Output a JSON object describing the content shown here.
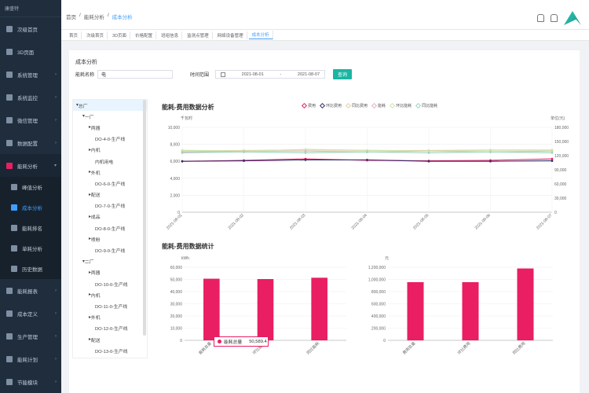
{
  "sidebar": {
    "brand": "康盛特",
    "items": [
      {
        "label": "次级首页"
      },
      {
        "label": "3D页面"
      },
      {
        "label": "系统管理"
      },
      {
        "label": "系统监控"
      },
      {
        "label": "微信管理"
      },
      {
        "label": "数据配置"
      },
      {
        "label": "能耗分析"
      },
      {
        "label": "能耗报表"
      },
      {
        "label": "成本定义"
      },
      {
        "label": "生产管理"
      },
      {
        "label": "能耗计划"
      },
      {
        "label": "节能模块"
      }
    ],
    "subitems": [
      {
        "label": "峰值分析"
      },
      {
        "label": "成本分析"
      },
      {
        "label": "能耗排名"
      },
      {
        "label": "单耗分析"
      },
      {
        "label": "历史数据"
      }
    ]
  },
  "breadcrumb": {
    "home": "首页",
    "sep": "/",
    "parent": "能耗分析",
    "current": "成本分析"
  },
  "tabs": [
    "首页",
    "次级首页",
    "3D页面",
    "价格配置",
    "班组信息",
    "监测点管理",
    "网络设备管理",
    "成本分析"
  ],
  "filter": {
    "title": "成本分析",
    "dim_label": "能耗名称",
    "dim_value": "电",
    "time_label": "时间范围",
    "start": "2021-08-01",
    "dash": "-",
    "end": "2021-08-07",
    "query": "查询"
  },
  "tree": [
    {
      "label": "总厂",
      "level": 0
    },
    {
      "label": "一厂",
      "level": 1
    },
    {
      "label": "两器",
      "level": 2
    },
    {
      "label": "DO-4-0-生产线",
      "level": 3
    },
    {
      "label": "内机",
      "level": 2
    },
    {
      "label": "内机用电",
      "level": 3
    },
    {
      "label": "外机",
      "level": 2
    },
    {
      "label": "DO-6-0-生产线",
      "level": 3
    },
    {
      "label": "配送",
      "level": 2
    },
    {
      "label": "DO-7-0-生产线",
      "level": 3
    },
    {
      "label": "成品",
      "level": 2
    },
    {
      "label": "DO-8-0-生产线",
      "level": 3
    },
    {
      "label": "喷粉",
      "level": 2
    },
    {
      "label": "DO-9-0-生产线",
      "level": 3
    },
    {
      "label": "二厂",
      "level": 1
    },
    {
      "label": "两器",
      "level": 2
    },
    {
      "label": "DO-10-0-生产线",
      "level": 3
    },
    {
      "label": "内机",
      "level": 2
    },
    {
      "label": "DO-11-0-生产线",
      "level": 3
    },
    {
      "label": "外机",
      "level": 2
    },
    {
      "label": "DO-12-0-生产线",
      "level": 3
    },
    {
      "label": "配送",
      "level": 2
    },
    {
      "label": "DO-13-0-生产线",
      "level": 3
    },
    {
      "label": "成品",
      "level": 2
    }
  ],
  "chart_data": [
    {
      "type": "line",
      "title": "能耗-费用数据分析",
      "ylabel": "千瓦时",
      "y2label": "单位(元)",
      "ylim": [
        0,
        10000
      ],
      "y2lim": [
        0,
        180000
      ],
      "yticks": [
        "0",
        "2,000",
        "4,000",
        "6,000",
        "8,000",
        "10,000"
      ],
      "y2ticks": [
        "0",
        "30,000",
        "60,000",
        "90,000",
        "120,000",
        "150,000",
        "180,000"
      ],
      "x": [
        "2021-08-01",
        "2021-08-02",
        "2021-08-03",
        "2021-08-04",
        "2021-08-05",
        "2021-08-06",
        "2021-08-07"
      ],
      "legend": [
        "费用",
        "环比费用",
        "同比费用",
        "能耗",
        "环比能耗",
        "同比能耗"
      ],
      "series": [
        {
          "name": "费用",
          "axis": "y2",
          "color": "#e91e63",
          "values": [
            108000,
            110000,
            113000,
            110000,
            109000,
            110000,
            113000
          ]
        },
        {
          "name": "环比费用",
          "axis": "y2",
          "color": "#3a2d6b",
          "values": [
            108000,
            109000,
            111000,
            111000,
            108000,
            108000,
            109000
          ]
        },
        {
          "name": "同比费用",
          "axis": "y2",
          "color": "#e6cfa3",
          "values": [
            130000,
            131000,
            132000,
            131000,
            131000,
            132000,
            132000
          ]
        },
        {
          "name": "能耗",
          "axis": "y",
          "color": "#e0b0c8",
          "values": [
            7100,
            7200,
            7200,
            7100,
            7200,
            7100,
            7200
          ]
        },
        {
          "name": "环比能耗",
          "axis": "y",
          "color": "#c9e6a8",
          "values": [
            7300,
            7200,
            7400,
            7300,
            7200,
            7300,
            7300
          ]
        },
        {
          "name": "同比能耗",
          "axis": "y",
          "color": "#9fd3bb",
          "values": [
            7000,
            7100,
            7000,
            7100,
            7000,
            7100,
            7000
          ]
        }
      ]
    },
    {
      "type": "bar",
      "title": "能耗-费用数据统计",
      "ylabel": "kWh",
      "categories": [
        "能耗总量",
        "环比能耗",
        "同比能耗"
      ],
      "values": [
        50589.4,
        50300,
        51400
      ],
      "ylim": [
        0,
        60000
      ],
      "yticks": [
        "0",
        "10,000",
        "20,000",
        "30,000",
        "40,000",
        "50,000",
        "60,000"
      ],
      "color": "#e91e63",
      "tooltip": {
        "label": "能耗总量",
        "value": "50,589.4"
      }
    },
    {
      "type": "bar",
      "ylabel": "元",
      "categories": [
        "费用总量",
        "环比费用",
        "同比费用"
      ],
      "values": [
        955000,
        955000,
        1180000
      ],
      "ylim": [
        0,
        1200000
      ],
      "yticks": [
        "0",
        "200,000",
        "400,000",
        "600,000",
        "800,000",
        "1,000,000",
        "1,200,000"
      ],
      "color": "#e91e63"
    }
  ]
}
